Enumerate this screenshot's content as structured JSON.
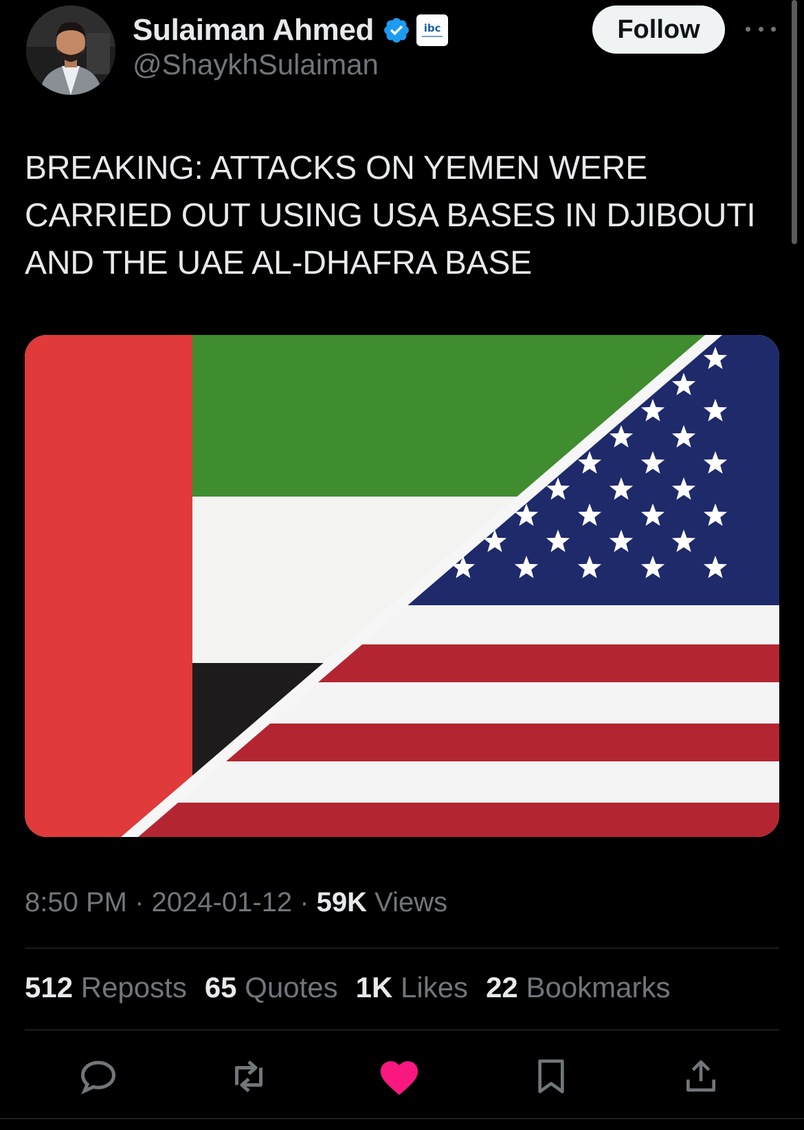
{
  "author": {
    "display_name": "Sulaiman Ahmed",
    "handle": "@ShaykhSulaiman",
    "verified_icon": "verified-badge-icon",
    "affiliation_badge_text": "ibc"
  },
  "actions_top": {
    "follow_label": "Follow",
    "more_icon": "more-horizontal-icon"
  },
  "tweet": {
    "text": "BREAKING: ATTACKS ON YEMEN WERE CARRIED OUT USING USA BASES IN DJIBOUTI AND THE UAE AL-DHAFRA BASE",
    "media_description_icon": "uae-usa-flags-image"
  },
  "meta": {
    "time": "8:50 PM",
    "sep1": " · ",
    "date": "2024-01-12",
    "sep2": " · ",
    "views_count": "59K",
    "views_label": " Views"
  },
  "stats": [
    {
      "count": "512",
      "label": " Reposts"
    },
    {
      "count": "65",
      "label": " Quotes"
    },
    {
      "count": "1K",
      "label": " Likes"
    },
    {
      "count": "22",
      "label": " Bookmarks"
    }
  ],
  "bottom_actions": [
    "reply-icon",
    "repost-icon",
    "like-icon",
    "bookmark-icon",
    "share-icon"
  ],
  "colors": {
    "background": "#000000",
    "primary_text": "#e7e9ea",
    "secondary_text": "#71767b",
    "verified_blue": "#1d9bf0",
    "like_pink": "#f91880",
    "uae_red": "#e03a3a",
    "uae_green": "#3f8d2f",
    "usa_blue": "#1f2a6b",
    "usa_red": "#b32631"
  }
}
